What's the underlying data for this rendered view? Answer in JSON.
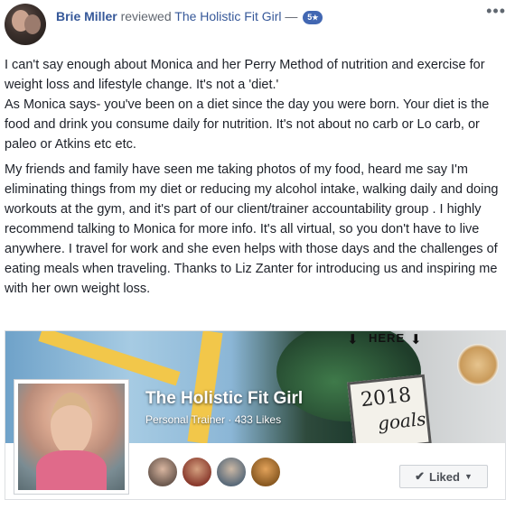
{
  "header": {
    "author": "Brie Miller",
    "verb": "reviewed",
    "page_name": "The Holistic Fit Girl",
    "dash": "—",
    "rating": "5",
    "rating_icon": "★",
    "more_icon": "•••"
  },
  "body": {
    "paragraphs": [
      "I can't say enough about Monica and her Perry Method of nutrition and exercise for weight loss and lifestyle change. It's not a 'diet.'",
      "As Monica says- you've been on a diet since the day you were born. Your diet is the food and drink you consume daily for nutrition. It's not about no carb or Lo carb, or paleo or Atkins etc etc.",
      "My friends and family have seen me taking photos of my food, heard me say I'm eliminating things from my diet or reducing my alcohol intake, walking daily and doing workouts at the gym, and it's part of our client/trainer accountability group . I highly recommend talking to Monica for more info. It's all virtual, so you don't have to live anywhere. I travel for work and she even helps with those days and the challenges of eating meals when traveling. Thanks to Liz Zanter for introducing us and inspiring me with her own weight loss."
    ]
  },
  "preview": {
    "cover_here_text": "HERE",
    "cover_arrow": "⬇",
    "cover_year": "2018",
    "cover_goals": "goals",
    "page_title": "The Holistic Fit Girl",
    "category": "Personal Trainer",
    "separator": "·",
    "likes": "433 Likes",
    "liked_label": "Liked",
    "check_icon": "✔",
    "caret_icon": "▼"
  }
}
